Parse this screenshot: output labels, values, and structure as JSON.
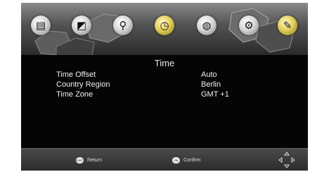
{
  "menu": {
    "items": [
      {
        "name": "channel-icon",
        "glyph": "▤"
      },
      {
        "name": "picture-icon",
        "glyph": "◩"
      },
      {
        "name": "search-icon",
        "glyph": "⚲"
      },
      {
        "name": "clock-icon",
        "glyph": "◷"
      },
      {
        "name": "globe-icon",
        "glyph": "◍"
      },
      {
        "name": "settings-icon",
        "glyph": "⚙"
      },
      {
        "name": "tools-icon",
        "glyph": "✎"
      }
    ],
    "active_index": 3
  },
  "page": {
    "title": "Time"
  },
  "settings": {
    "time_offset": {
      "label": "Time Offset",
      "value": "Auto"
    },
    "country_region": {
      "label": "Country Region",
      "value": "Berlin"
    },
    "time_zone": {
      "label": "Time Zone",
      "value": "GMT +1"
    }
  },
  "footer": {
    "return_key": "EXIT",
    "return_label": "Return",
    "confirm_key": "OK",
    "confirm_label": "Confirm"
  }
}
